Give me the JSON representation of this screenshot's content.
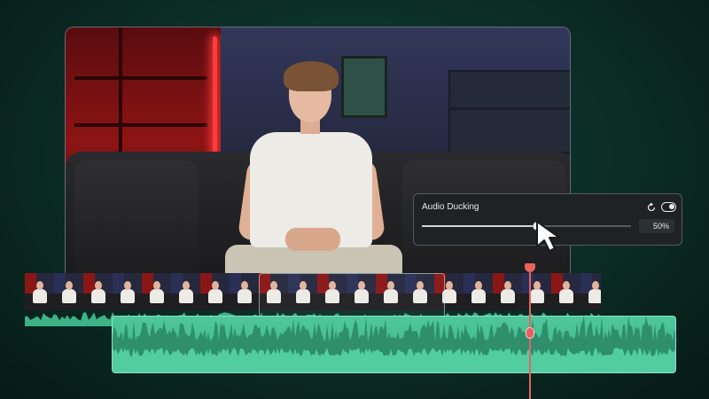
{
  "audio_ducking": {
    "title": "Audio Ducking",
    "value_label": "50%",
    "level_fraction": 0.55,
    "enabled": true,
    "reset_icon": "reset-icon",
    "toggle_icon": "toggle-switch-icon"
  },
  "timeline": {
    "video_track_thumbnails": 20,
    "playhead_icon": "playhead-icon",
    "keyframe_icon": "keyframe-icon"
  },
  "colors": {
    "accent_green": "#3db287",
    "playhead_red": "#e8615f",
    "panel_bg": "#1e2225"
  }
}
